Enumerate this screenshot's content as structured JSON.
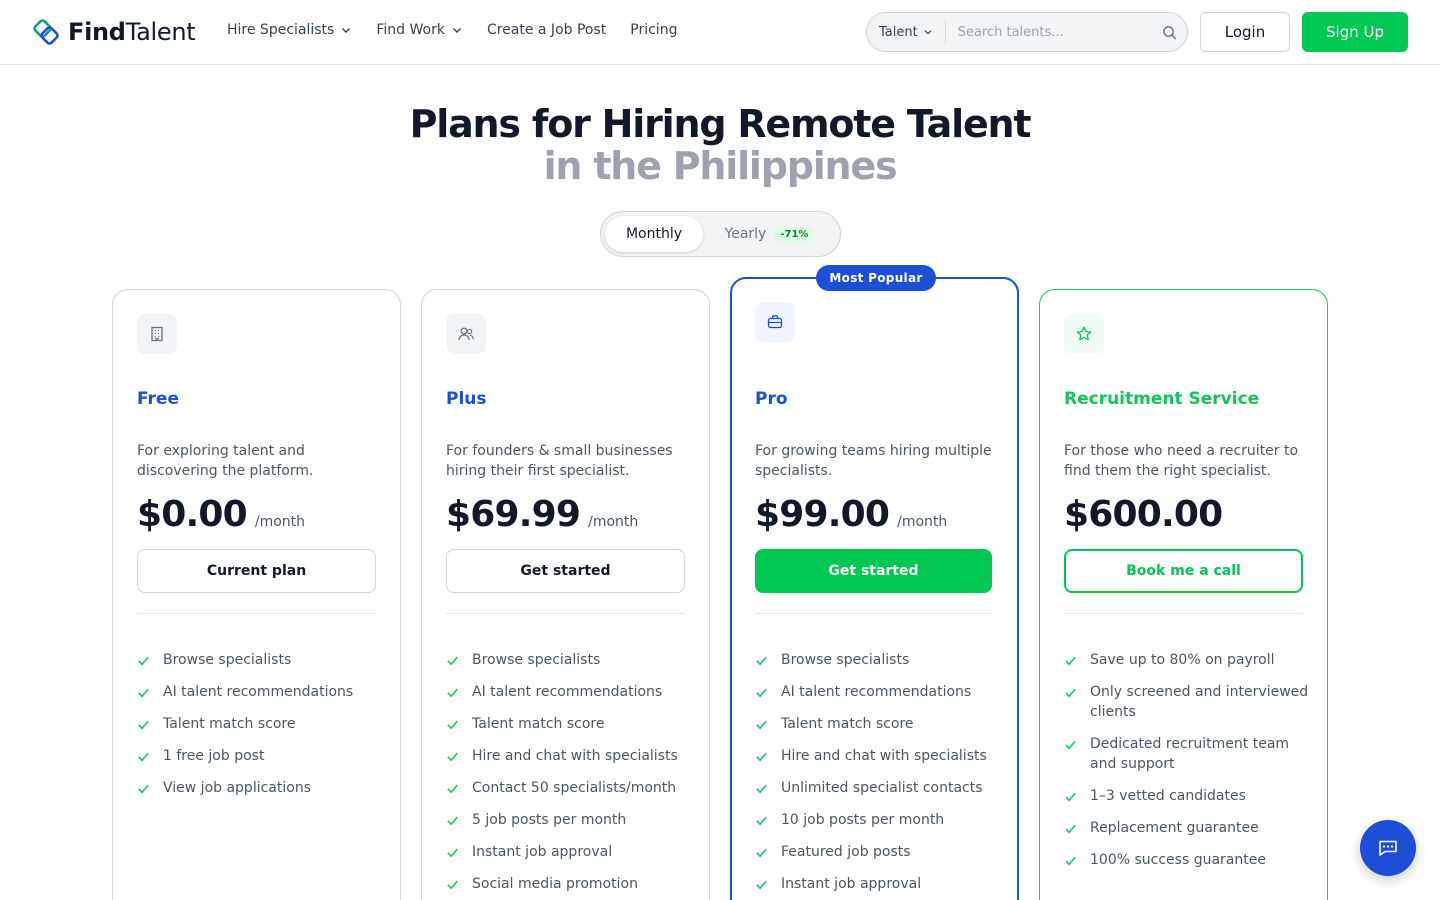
{
  "brand": {
    "name_bold": "Find",
    "name_rest": "Talent"
  },
  "nav": [
    {
      "label": "Hire Specialists",
      "dropdown": true
    },
    {
      "label": "Find Work",
      "dropdown": true
    },
    {
      "label": "Create a Job Post",
      "dropdown": false
    },
    {
      "label": "Pricing",
      "dropdown": false
    }
  ],
  "search": {
    "category": "Talent",
    "placeholder": "Search talents..."
  },
  "auth": {
    "login": "Login",
    "signup": "Sign Up"
  },
  "hero": {
    "line1": "Plans for Hiring Remote Talent",
    "line2": "in the Philippines"
  },
  "billing_toggle": {
    "monthly": "Monthly",
    "yearly": "Yearly",
    "discount": "-71%",
    "selected": "Monthly"
  },
  "plans": [
    {
      "name": "Free",
      "icon": "building-icon",
      "description": "For exploring talent and discovering the platform.",
      "price": "$0.00",
      "period": "/month",
      "button": "Current plan",
      "features": [
        "Browse specialists",
        "AI talent recommendations",
        "Talent match score",
        "1 free job post",
        "View job applications"
      ]
    },
    {
      "name": "Plus",
      "icon": "users-icon",
      "description": "For founders & small businesses hiring their first specialist.",
      "price": "$69.99",
      "period": "/month",
      "button": "Get started",
      "features": [
        "Browse specialists",
        "AI talent recommendations",
        "Talent match score",
        "Hire and chat with specialists",
        "Contact 50 specialists/month",
        "5 job posts per month",
        "Instant job approval",
        "Social media promotion"
      ]
    },
    {
      "name": "Pro",
      "badge": "Most Popular",
      "icon": "briefcase-icon",
      "description": "For growing teams hiring multiple specialists.",
      "price": "$99.00",
      "period": "/month",
      "button": "Get started",
      "features": [
        "Browse specialists",
        "AI talent recommendations",
        "Talent match score",
        "Hire and chat with specialists",
        "Unlimited specialist contacts",
        "10 job posts per month",
        "Featured job posts",
        "Instant job approval"
      ]
    },
    {
      "name": "Recruitment Service",
      "icon": "star-icon",
      "description": "For those who need a recruiter to find them the right specialist.",
      "price": "$600.00",
      "period": "",
      "button": "Book me a call",
      "features": [
        "Save up to 80% on payroll",
        "Only screened and interviewed clients",
        "Dedicated recruitment team and support",
        "1–3 vetted candidates",
        "Replacement guarantee",
        "100% success guarantee"
      ]
    }
  ],
  "colors": {
    "brand_green": "#00c853",
    "brand_blue": "#1d4ed8",
    "recruit_green": "#16c25a",
    "plan_name_blue": "#1d4ed8"
  },
  "chat": {
    "icon": "chat-icon"
  }
}
